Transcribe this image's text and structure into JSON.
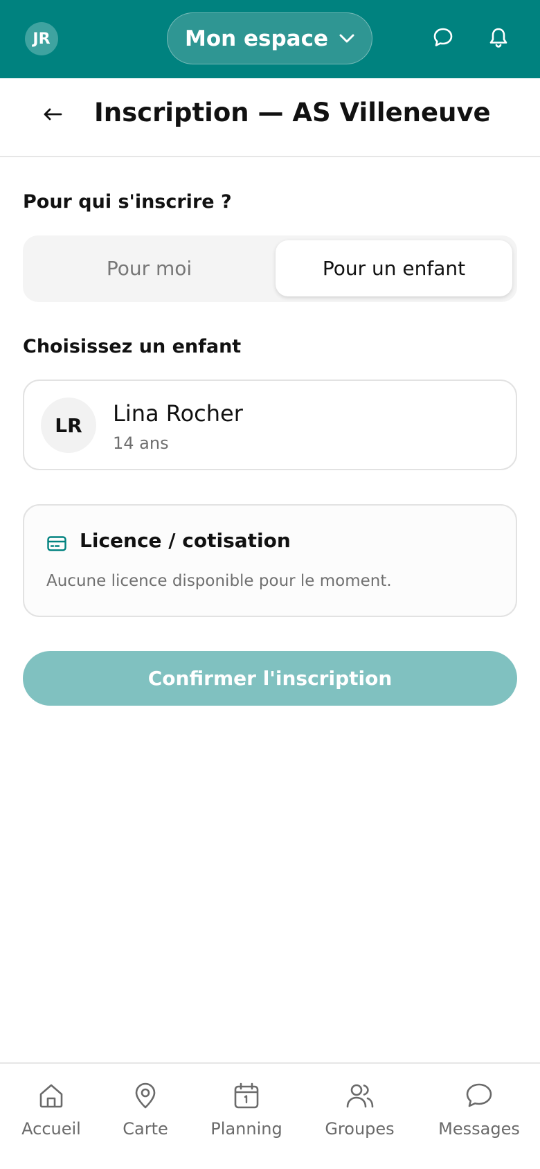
{
  "header": {
    "avatar_initials": "JR",
    "space_label": "Mon espace",
    "icons": [
      "chat-icon",
      "bell-icon"
    ]
  },
  "page": {
    "title": "Inscription — AS Villeneuve"
  },
  "who": {
    "label": "Pour qui s'inscrire ?",
    "options": [
      {
        "label": "Pour moi",
        "selected": false
      },
      {
        "label": "Pour un enfant",
        "selected": true
      }
    ]
  },
  "child_select": {
    "label": "Choisissez un enfant",
    "children": [
      {
        "initials": "LR",
        "name": "Lina Rocher",
        "age": "14 ans"
      }
    ]
  },
  "licence": {
    "title": "Licence / cotisation",
    "empty_text": "Aucune licence disponible pour le moment.",
    "icon": "card-icon"
  },
  "confirm": {
    "label": "Confirmer l'inscription",
    "enabled": false
  },
  "nav": {
    "items": [
      {
        "label": "Accueil",
        "icon": "home-icon"
      },
      {
        "label": "Carte",
        "icon": "map-pin-icon"
      },
      {
        "label": "Planning",
        "icon": "calendar-icon"
      },
      {
        "label": "Groupes",
        "icon": "users-icon"
      },
      {
        "label": "Messages",
        "icon": "chat-icon"
      }
    ]
  },
  "colors": {
    "primary": "#00827f",
    "primary_disabled": "#80c1c0",
    "muted_text": "#6f6f6f"
  }
}
